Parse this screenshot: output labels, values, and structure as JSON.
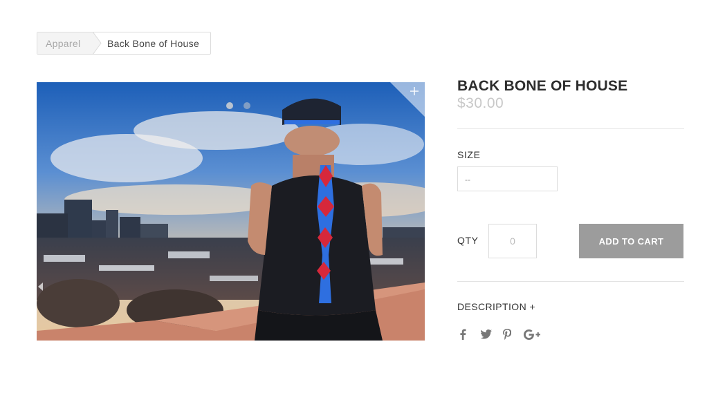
{
  "breadcrumb": {
    "first": "Apparel",
    "current": "Back Bone of House"
  },
  "product": {
    "title": "BACK BONE OF HOUSE",
    "price": "$30.00",
    "image_alt": "Back Bone of House tank top photo"
  },
  "options": {
    "size_label": "SIZE",
    "size_selected": "--",
    "qty_label": "QTY",
    "qty_placeholder": "0",
    "add_to_cart_label": "ADD TO CART",
    "description_label": "DESCRIPTION +"
  },
  "social": {
    "facebook": "f",
    "twitter": "t",
    "pinterest": "p",
    "googleplus": "G+"
  },
  "colors": {
    "button": "#9c9c9c",
    "price": "#c8c8c8",
    "accent_blue": "#2e6fe0"
  },
  "icons": [
    "zoom-plus-icon",
    "facebook-icon",
    "twitter-icon",
    "pinterest-icon",
    "google-plus-icon"
  ]
}
